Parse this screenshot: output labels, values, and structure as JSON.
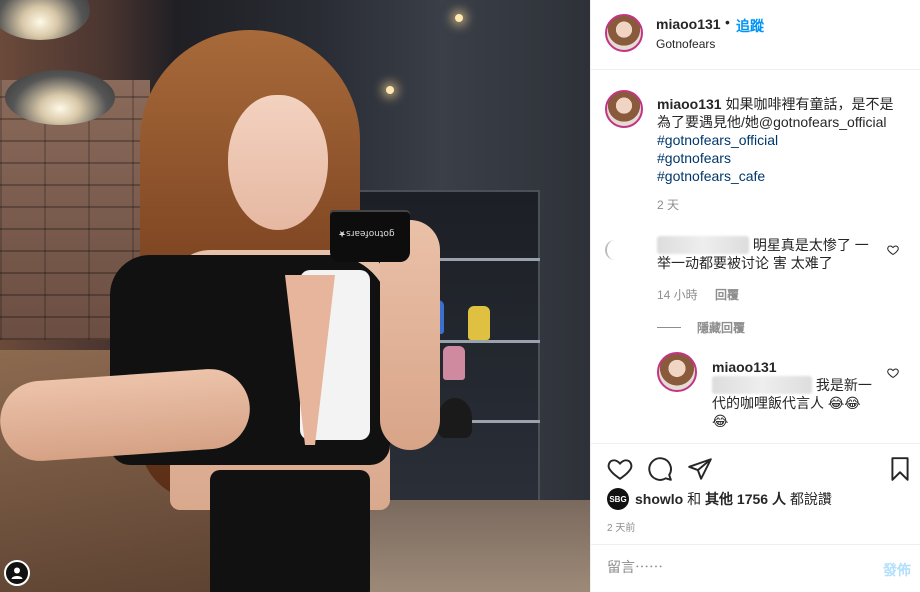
{
  "header": {
    "username": "miaoo131",
    "separator": "•",
    "follow_label": "追蹤",
    "location": "Gotnofears"
  },
  "caption": {
    "username": "miaoo131",
    "text": " 如果咖啡裡有童話，是不是為了要遇見他/她@gotnofears_official",
    "hashtags": [
      "#gotnofears_official",
      "#gotnofears",
      "#gotnofears_cafe"
    ],
    "time": "2 天"
  },
  "comments": [
    {
      "text": "明星真是太惨了 一举一动都要被讨论 害 太难了",
      "time": "14 小時",
      "reply_label": "回覆",
      "hide_replies_label": "隱藏回覆",
      "replies": [
        {
          "username": "miaoo131",
          "text": "我是新一代的咖哩飯代言人",
          "emoji": "😂😂😂"
        }
      ]
    }
  ],
  "actions": {
    "icons": [
      "heart-icon",
      "comment-icon",
      "share-icon",
      "bookmark-icon"
    ],
    "likes_user": "showlo",
    "likes_joiner": "和",
    "likes_others": "其他 1756 人",
    "likes_suffix": "都說讚",
    "post_time": "2 天前"
  },
  "comment_box": {
    "placeholder": "留言⋯⋯",
    "post_label": "發佈"
  },
  "photo": {
    "cup_text": "gotnofears★"
  },
  "colors": {
    "link": "#00376b",
    "follow": "#0095f6",
    "post_disabled": "#b2dffc",
    "muted": "#8e8e8e"
  }
}
